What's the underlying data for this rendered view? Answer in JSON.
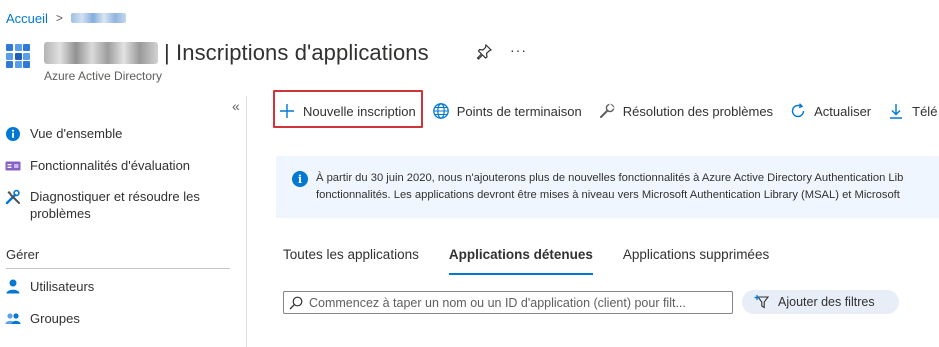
{
  "breadcrumb": {
    "home": "Accueil",
    "separator": ">"
  },
  "header": {
    "title": "| Inscriptions d'applications",
    "subtitle": "Azure Active Directory",
    "more": "···"
  },
  "sidebar": {
    "items": [
      {
        "label": "Vue d'ensemble",
        "icon": "info-icon"
      },
      {
        "label": "Fonctionnalités d'évaluation",
        "icon": "preview-features-icon"
      },
      {
        "label": "Diagnostiquer et résoudre les problèmes",
        "icon": "tools-icon"
      }
    ],
    "section_header": "Gérer",
    "manage_items": [
      {
        "label": "Utilisateurs",
        "icon": "user-icon"
      },
      {
        "label": "Groupes",
        "icon": "group-icon"
      }
    ],
    "collapse": "«"
  },
  "toolbar": {
    "new_registration": "Nouvelle inscription",
    "endpoints": "Points de terminaison",
    "troubleshooting": "Résolution des problèmes",
    "refresh": "Actualiser",
    "download": "Télé"
  },
  "banner": {
    "line1": "À partir du 30 juin 2020, nous n'ajouterons plus de nouvelles fonctionnalités à Azure Active Directory Authentication Lib",
    "line2": "fonctionnalités. Les applications devront être mises à niveau vers Microsoft Authentication Library (MSAL) et Microsoft"
  },
  "tabs": [
    {
      "label": "Toutes les applications",
      "active": false
    },
    {
      "label": "Applications détenues",
      "active": true
    },
    {
      "label": "Applications supprimées",
      "active": false
    }
  ],
  "search": {
    "placeholder": "Commencez à taper un nom ou un ID d'application (client) pour filt..."
  },
  "filter": {
    "label": "Ajouter des filtres"
  },
  "colors": {
    "accent": "#0078d4",
    "highlight": "#d13438",
    "banner_bg": "#f0f6ff"
  }
}
